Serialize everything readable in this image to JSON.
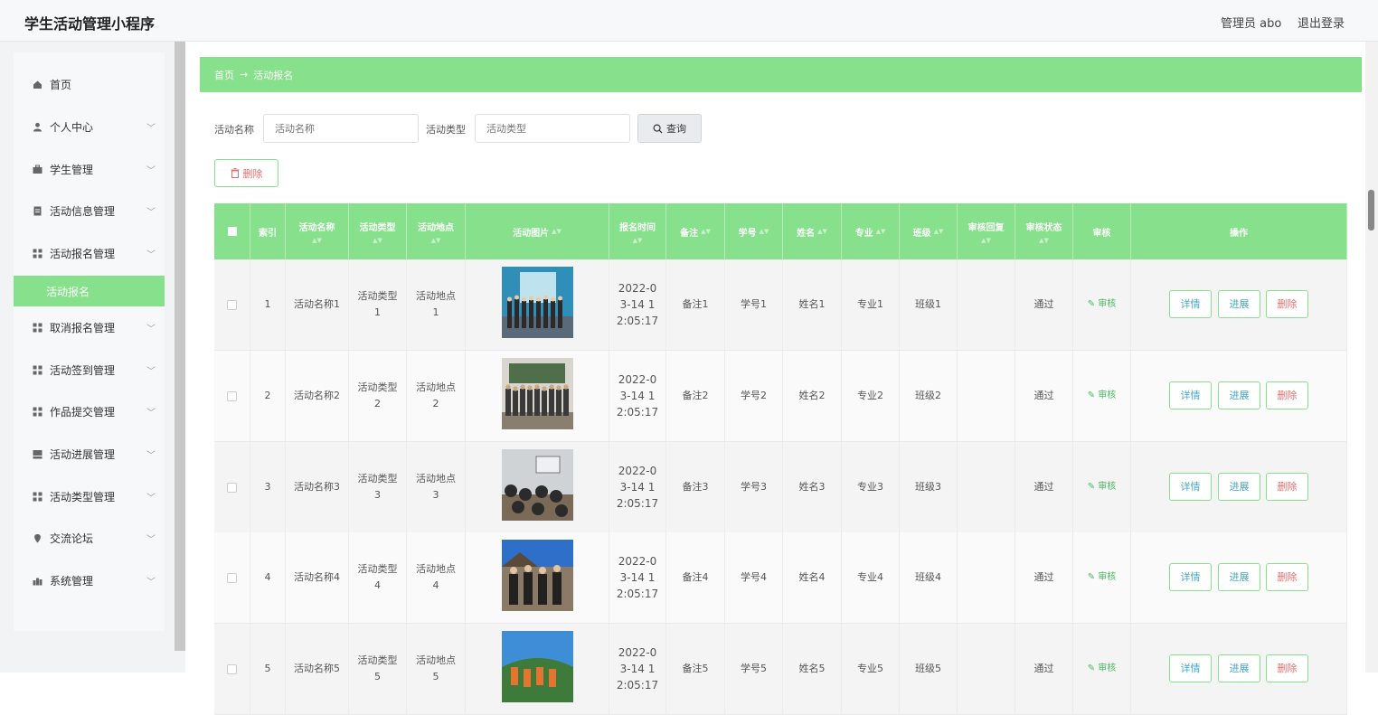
{
  "app_title": "学生活动管理小程序",
  "header": {
    "admin": "管理员 abo",
    "logout": "退出登录"
  },
  "sidebar": {
    "items": [
      {
        "label": "首页",
        "icon": "home-icon",
        "has_chevron": false
      },
      {
        "label": "个人中心",
        "icon": "user-icon",
        "has_chevron": true
      },
      {
        "label": "学生管理",
        "icon": "briefcase-icon",
        "has_chevron": true
      },
      {
        "label": "活动信息管理",
        "icon": "doc-icon",
        "has_chevron": true
      },
      {
        "label": "活动报名管理",
        "icon": "grid-icon",
        "has_chevron": true
      },
      {
        "label": "活动报名",
        "sub": true,
        "active": true
      },
      {
        "label": "取消报名管理",
        "icon": "grid-icon",
        "has_chevron": true
      },
      {
        "label": "活动签到管理",
        "icon": "grid-icon",
        "has_chevron": true
      },
      {
        "label": "作品提交管理",
        "icon": "grid-icon",
        "has_chevron": true
      },
      {
        "label": "活动进展管理",
        "icon": "tray-icon",
        "has_chevron": true
      },
      {
        "label": "活动类型管理",
        "icon": "grid-icon",
        "has_chevron": true
      },
      {
        "label": "交流论坛",
        "icon": "pin-icon",
        "has_chevron": true
      },
      {
        "label": "系统管理",
        "icon": "chart-icon",
        "has_chevron": true
      }
    ]
  },
  "breadcrumb": {
    "home": "首页",
    "arrow": "→",
    "current": "活动报名"
  },
  "search": {
    "name_label": "活动名称",
    "name_placeholder": "活动名称",
    "type_label": "活动类型",
    "type_placeholder": "活动类型",
    "query_label": "查询"
  },
  "toolbar": {
    "delete_label": "删除"
  },
  "table": {
    "columns": [
      "",
      "索引",
      "活动名称",
      "活动类型",
      "活动地点",
      "活动图片",
      "报名时间",
      "备注",
      "学号",
      "姓名",
      "专业",
      "班级",
      "审核回复",
      "审核状态",
      "审核",
      "操作"
    ],
    "rows": [
      {
        "index": "1",
        "name": "活动名称1",
        "type": "活动类型1",
        "place": "活动地点1",
        "time": "2022-03-14 12:05:17",
        "note": "备注1",
        "sid": "学号1",
        "sname": "姓名1",
        "major": "专业1",
        "cls": "班级1",
        "reply": "",
        "status": "通过"
      },
      {
        "index": "2",
        "name": "活动名称2",
        "type": "活动类型2",
        "place": "活动地点2",
        "time": "2022-03-14 12:05:17",
        "note": "备注2",
        "sid": "学号2",
        "sname": "姓名2",
        "major": "专业2",
        "cls": "班级2",
        "reply": "",
        "status": "通过"
      },
      {
        "index": "3",
        "name": "活动名称3",
        "type": "活动类型3",
        "place": "活动地点3",
        "time": "2022-03-14 12:05:17",
        "note": "备注3",
        "sid": "学号3",
        "sname": "姓名3",
        "major": "专业3",
        "cls": "班级3",
        "reply": "",
        "status": "通过"
      },
      {
        "index": "4",
        "name": "活动名称4",
        "type": "活动类型4",
        "place": "活动地点4",
        "time": "2022-03-14 12:05:17",
        "note": "备注4",
        "sid": "学号4",
        "sname": "姓名4",
        "major": "专业4",
        "cls": "班级4",
        "reply": "",
        "status": "通过"
      },
      {
        "index": "5",
        "name": "活动名称5",
        "type": "活动类型5",
        "place": "活动地点5",
        "time": "2022-03-14 12:05:17",
        "note": "备注5",
        "sid": "学号5",
        "sname": "姓名5",
        "major": "专业5",
        "cls": "班级5",
        "reply": "",
        "status": "通过"
      }
    ],
    "audit_label": "审核",
    "detail_label": "详情",
    "progress_label": "进展",
    "remove_label": "删除"
  },
  "colors": {
    "accent": "#87e08c",
    "danger": "#e07070",
    "info": "#4aa7c9"
  }
}
